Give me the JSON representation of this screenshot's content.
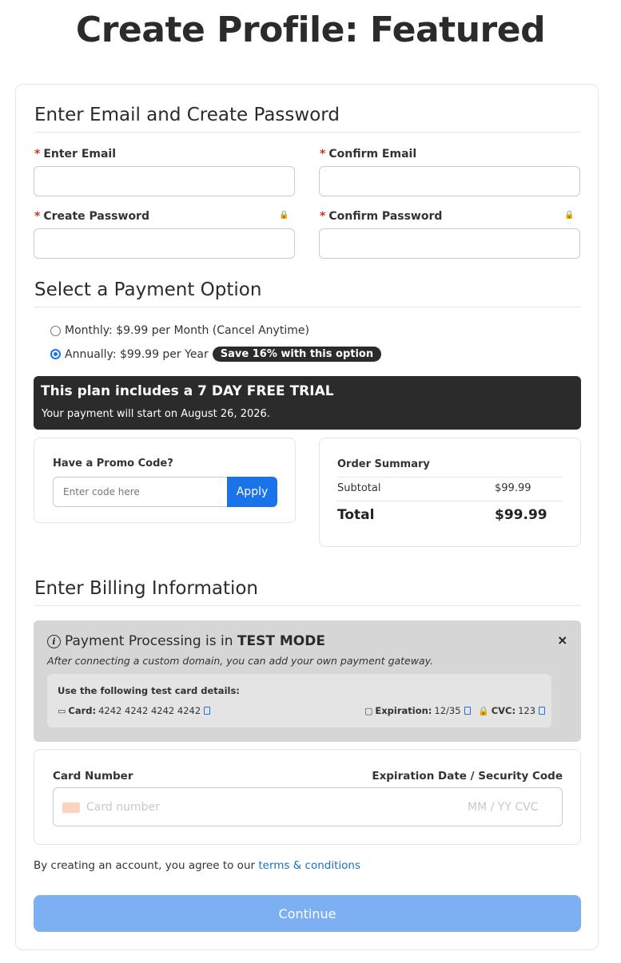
{
  "page": {
    "title": "Create Profile: Featured"
  },
  "account": {
    "heading": "Enter Email and Create Password",
    "required_mark": "*",
    "email_label": "Enter Email",
    "confirm_email_label": "Confirm Email",
    "password_label": "Create Password",
    "confirm_password_label": "Confirm Password",
    "email_value": "",
    "confirm_email_value": "",
    "password_value": "",
    "confirm_password_value": ""
  },
  "payment": {
    "heading": "Select a Payment Option",
    "options": [
      {
        "label": "Monthly: $9.99 per Month (Cancel Anytime)",
        "selected": false
      },
      {
        "label": "Annually: $99.99 per Year",
        "selected": true,
        "badge": "Save 16% with this option"
      }
    ],
    "trial_title": "This plan includes a 7 DAY FREE TRIAL",
    "trial_subtitle": "Your payment will start on August 26, 2026."
  },
  "promo": {
    "title": "Have a Promo Code?",
    "placeholder": "Enter code here",
    "apply_label": "Apply"
  },
  "summary": {
    "title": "Order Summary",
    "subtotal_label": "Subtotal",
    "subtotal_value": "$99.99",
    "total_label": "Total",
    "total_value": "$99.99"
  },
  "billing": {
    "heading": "Enter Billing Information",
    "test_prefix": "Payment Processing is in ",
    "test_mode": "TEST MODE",
    "test_subtitle": "After connecting a custom domain, you can add your own payment gateway.",
    "test_details_title": "Use the following test card details:",
    "card_key": "Card:",
    "card_value": "4242 4242 4242 4242",
    "exp_key": "Expiration:",
    "exp_value": "12/35",
    "cvc_key": "CVC:",
    "cvc_value": "123",
    "close_glyph": "×",
    "info_glyph": "i",
    "card_number_label": "Card Number",
    "exp_security_label": "Expiration Date / Security Code",
    "card_placeholder": "Card number",
    "exp_placeholder": "MM / YY  CVC"
  },
  "footer": {
    "terms_prefix": "By creating an account, you agree to our ",
    "terms_link": "terms & conditions",
    "continue_label": "Continue"
  },
  "colors": {
    "accent": "#1a73e8",
    "continue_disabled": "#7db0f3",
    "trial_bg": "#2b2b2b",
    "test_bg": "#d6d6d6",
    "required": "#c0392b"
  },
  "icons": [
    "lock-icon",
    "info-icon",
    "close-icon",
    "credit-card-icon",
    "calendar-icon",
    "cvc-lock-icon",
    "copy-icon"
  ]
}
